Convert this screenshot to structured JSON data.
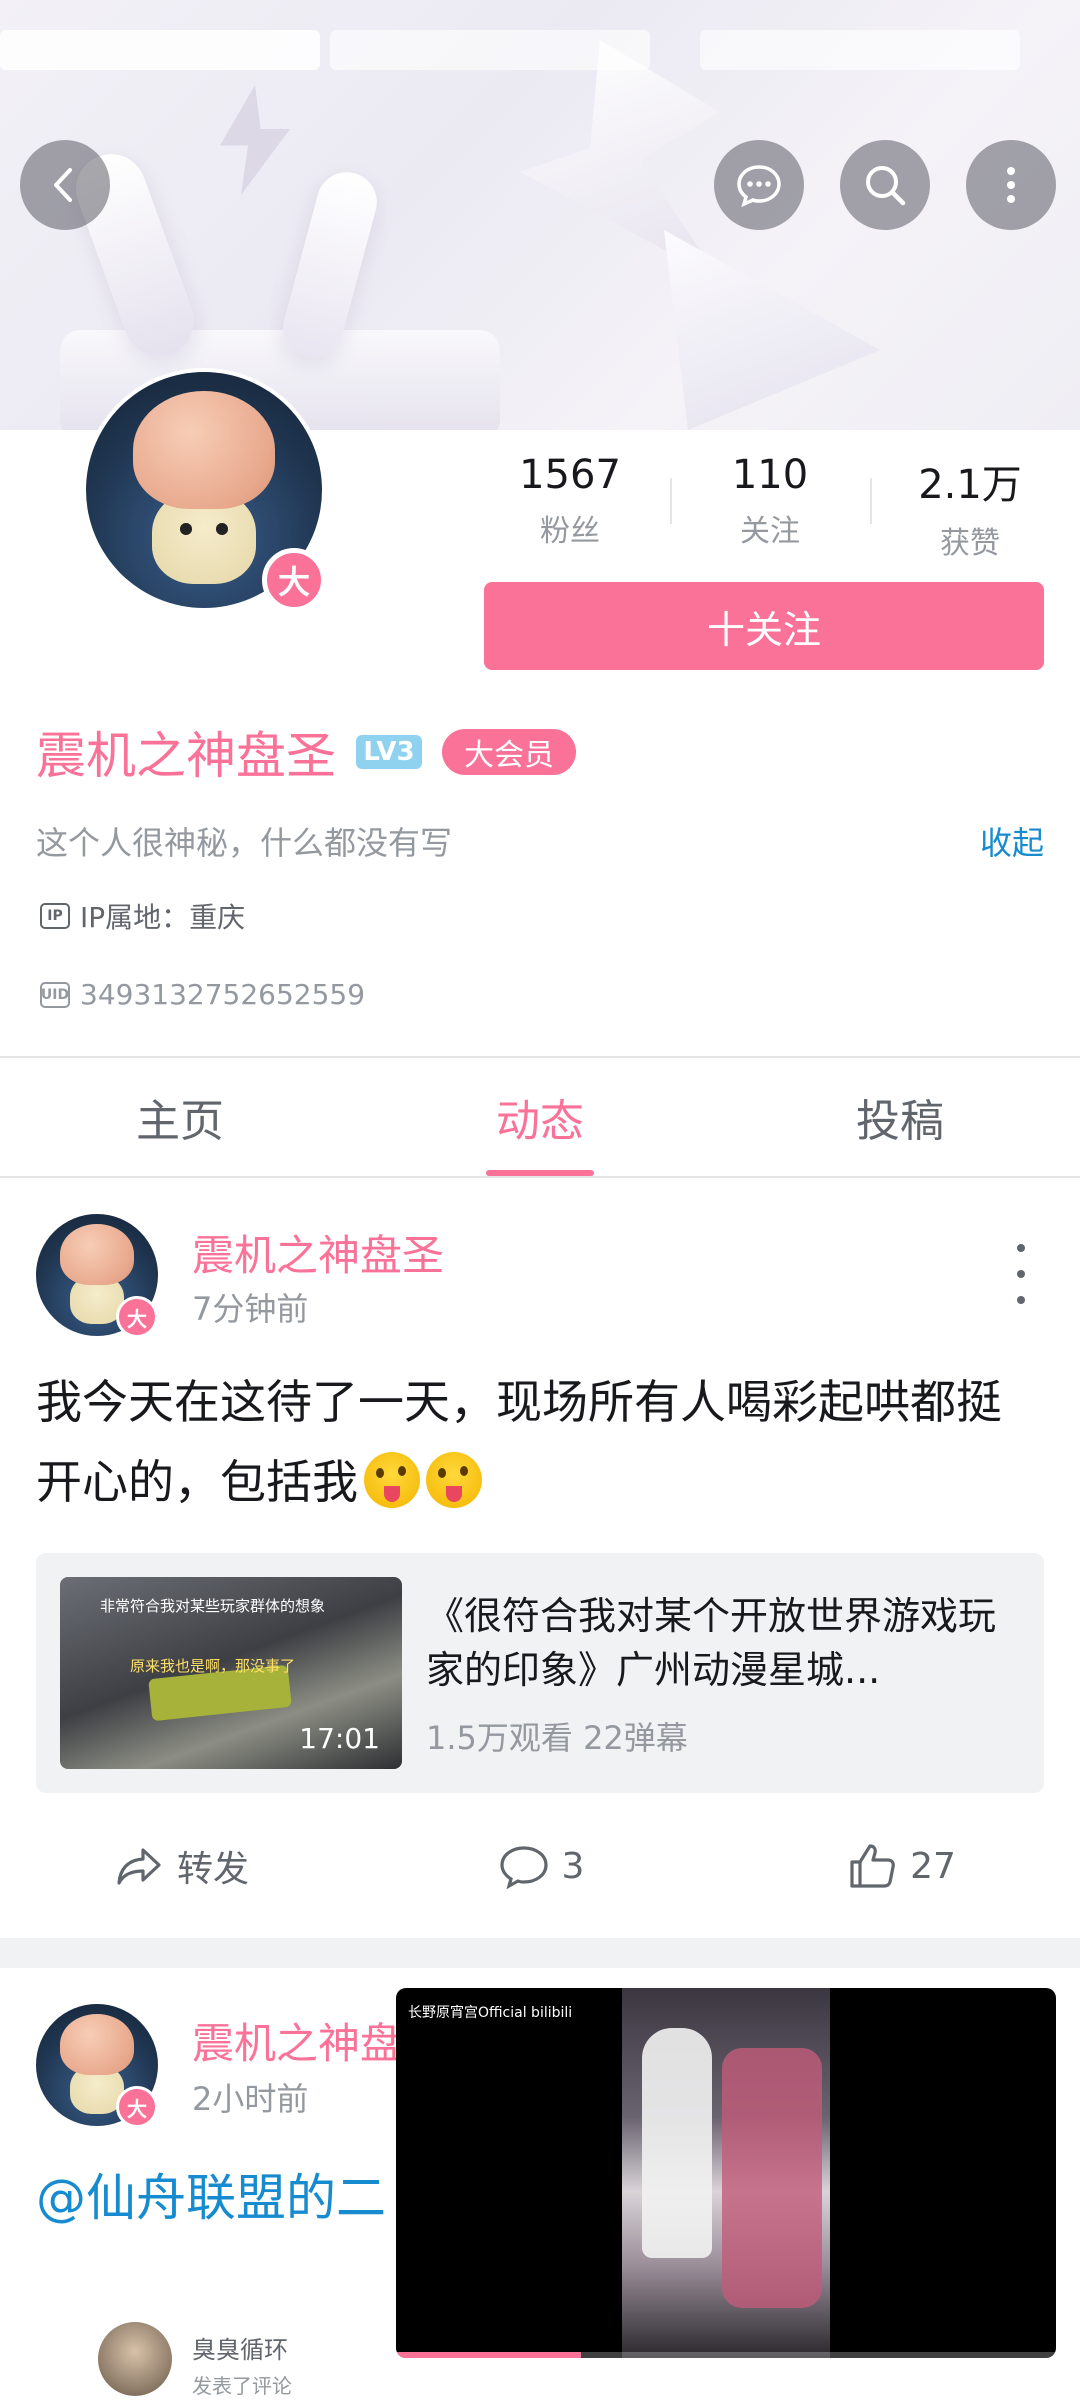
{
  "profile": {
    "name": "震机之神盘圣",
    "level": "LV3",
    "vip_label": "大会员",
    "vip_badge_char": "大",
    "bio": "这个人很神秘，什么都没有写",
    "collapse_label": "收起",
    "ip_tag": "IP",
    "ip_location": "IP属地：重庆",
    "uid_tag": "UID",
    "uid": "3493132752652559",
    "follow_button": "十关注"
  },
  "stats": [
    {
      "value": "1567",
      "label": "粉丝"
    },
    {
      "value": "110",
      "label": "关注"
    },
    {
      "value": "2.1万",
      "label": "获赞"
    }
  ],
  "tabs": [
    {
      "label": "主页",
      "active": false
    },
    {
      "label": "动态",
      "active": true
    },
    {
      "label": "投稿",
      "active": false
    }
  ],
  "posts": [
    {
      "author": "震机之神盘圣",
      "time": "7分钟前",
      "text": "我今天在这待了一天，现场所有人喝彩起哄都挺开心的，包括我",
      "video": {
        "thumb_caption_top": "非常符合我对某些玩家群体的想象",
        "thumb_caption_mid": "原来我也是啊，那没事了",
        "duration": "17:01",
        "title": "《很符合我对某个开放世界游戏玩家的印象》广州动漫星城...",
        "stats": "1.5万观看  22弹幕"
      },
      "actions": {
        "share": "转发",
        "comments": "3",
        "likes": "27"
      }
    },
    {
      "author": "震机之神盘圣",
      "time": "2小时前",
      "text_visible": "@仙舟联盟的二",
      "comment_user": "臭臭循环",
      "comment_sub": "发表了评论"
    }
  ],
  "mini_player": {
    "watermark": "长野原宵宫Official bilibili",
    "progress": 0.28
  },
  "colors": {
    "brand_pink": "#fb7299",
    "link_blue": "#178bcf"
  },
  "icons": [
    "back-icon",
    "message-icon",
    "search-icon",
    "more-icon",
    "share-icon",
    "comment-icon",
    "like-icon"
  ]
}
